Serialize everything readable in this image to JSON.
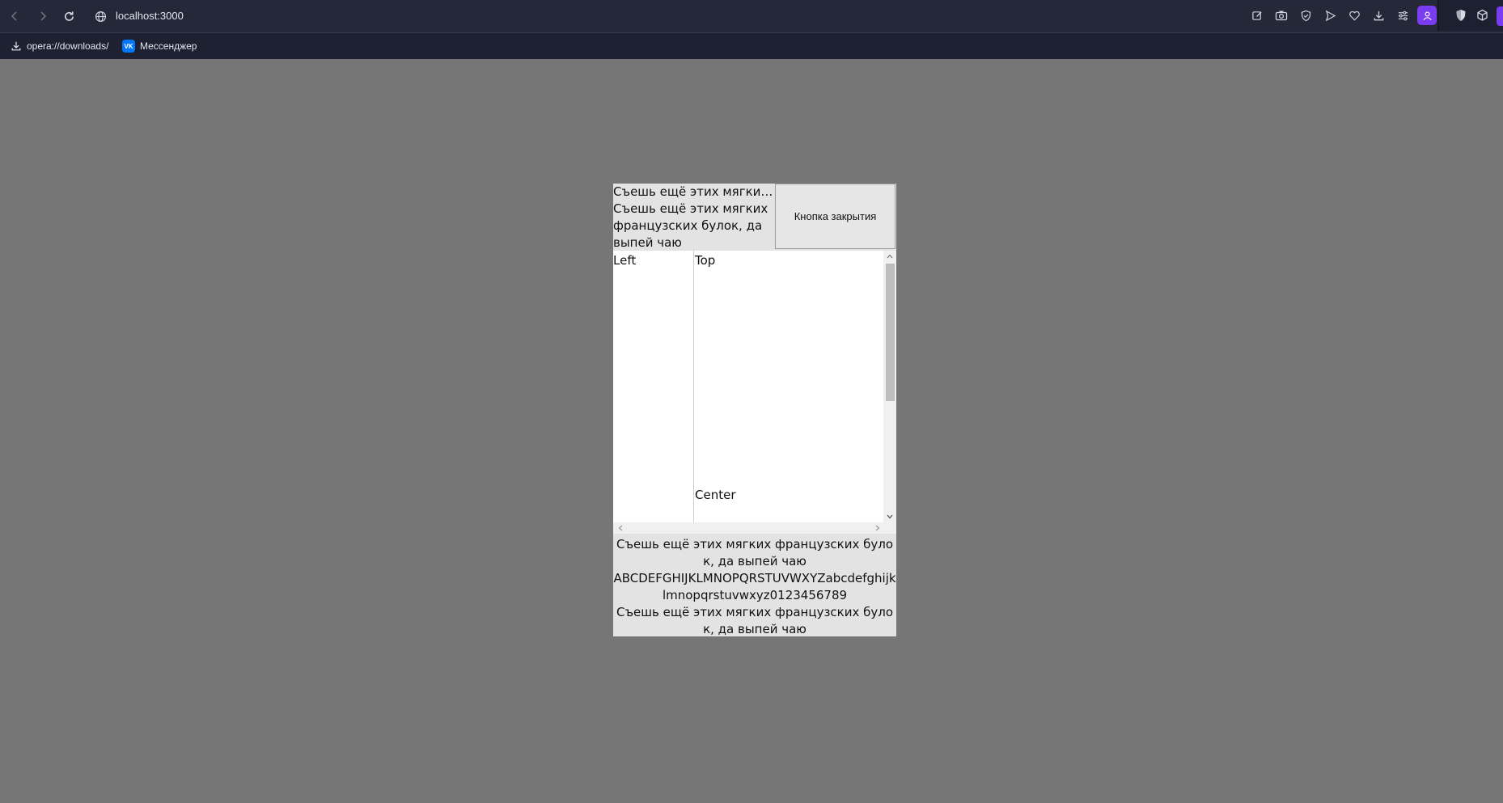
{
  "browser": {
    "url": "localhost:3000",
    "toolbar_icons": [
      "edit-icon",
      "camera-icon",
      "shield-icon",
      "send-icon",
      "heart-icon",
      "download-icon",
      "menu-icon",
      "profile-icon"
    ],
    "bookmarks": [
      {
        "label": "opera://downloads/",
        "icon": "download-icon"
      },
      {
        "label": "Мессенджер",
        "icon": "vk-icon",
        "badge": "VK"
      }
    ],
    "colors": {
      "toolbar_bg": "#242838",
      "accent": "#7a3cf0",
      "page_bg": "#767676"
    }
  },
  "window": {
    "title_line1": "Съешь ещё этих мягких ...",
    "title_rest": "Съешь ещё этих мягких французских булок, да выпей чаю",
    "close_label": "Кнопка закрытия",
    "left_label": "Left",
    "top_label": "Top",
    "center_label": "Center",
    "footer": [
      "Съешь ещё этих мягких французских булок, да выпей чаю",
      "ABCDEFGHIJKLMNOPQRSTUVWXYZabcdefghijklmnopqrstuvwxyz0123456789",
      "Съешь ещё этих мягких французских булок, да выпей чаю"
    ]
  }
}
